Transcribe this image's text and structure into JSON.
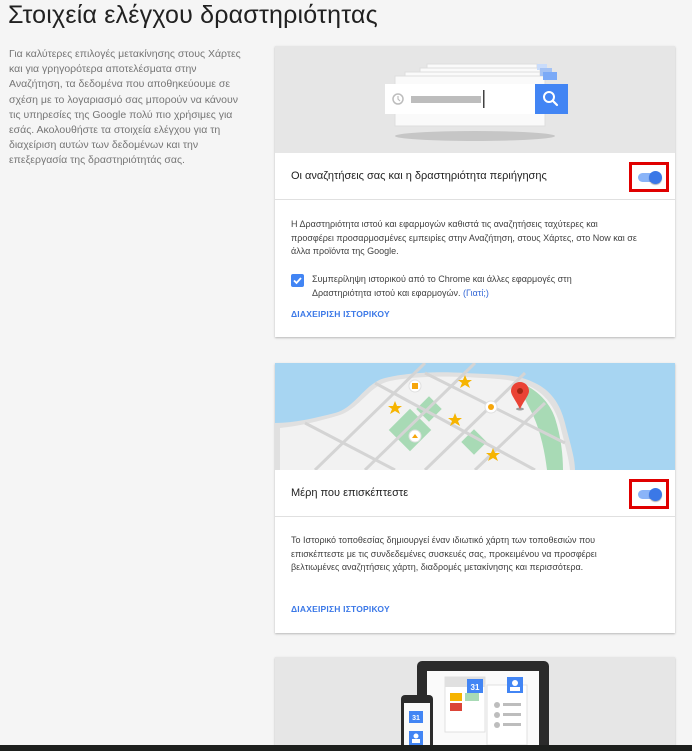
{
  "page": {
    "title": "Στοιχεία ελέγχου δραστηριότητας",
    "intro": "Για καλύτερες επιλογές μετακίνησης στους Χάρτες και για γρηγορότερα αποτελέσματα στην Αναζήτηση, τα δεδομένα που αποθηκεύουμε σε σχέση με το λογαριασμό σας μπορούν να κάνουν τις υπηρεσίες της Google πολύ πιο χρήσιμες για εσάς. Ακολουθήστε τα στοιχεία ελέγχου για τη διαχείριση αυτών των δεδομένων και την επεξεργασία της δραστηριότητάς σας."
  },
  "web_activity": {
    "label": "Οι αναζητήσεις σας και η δραστηριότητα περιήγησης",
    "enabled": true,
    "description": "Η Δραστηριότητα ιστού και εφαρμογών καθιστά τις αναζητήσεις ταχύτερες και προσφέρει προσαρμοσμένες εμπειρίες στην Αναζήτηση, στους Χάρτες, στο Now και σε άλλα προϊόντα της Google.",
    "checkbox_checked": true,
    "checkbox_label": "Συμπερίληψη ιστορικού από το Chrome και άλλες εφαρμογές στη Δραστηριότητα ιστού και εφαρμογών.",
    "why_link": "(Γιατί;)",
    "manage_label": "ΔΙΑΧΕΙΡΙΣΗ ΙΣΤΟΡΙΚΟΥ"
  },
  "location_history": {
    "label": "Μέρη που επισκέπτεστε",
    "enabled": true,
    "description": "Το Ιστορικό τοποθεσίας δημιουργεί έναν ιδιωτικό χάρτη των τοποθεσιών που επισκέπτεστε με τις συνδεδεμένες συσκευές σας, προκειμένου να προσφέρει βελτιωμένες αναζητήσεις χάρτη, διαδρομές μετακίνησης και περισσότερα.",
    "manage_label": "ΔΙΑΧΕΙΡΙΣΗ ΙΣΤΟΡΙΚΟΥ"
  },
  "device_info": {
    "calendar_day": "31"
  },
  "colors": {
    "accent": "#4285f4",
    "link": "#3b78e7",
    "highlight_box": "#e00000",
    "map_water": "#a7d5f2",
    "map_land": "#f2f2f2",
    "map_park": "#a8dab5",
    "pin": "#ea4335",
    "star": "#f6b400"
  },
  "icons": [
    "clock-icon",
    "search-icon",
    "map-pin-icon",
    "star-icon",
    "calendar-icon",
    "contact-icon"
  ]
}
